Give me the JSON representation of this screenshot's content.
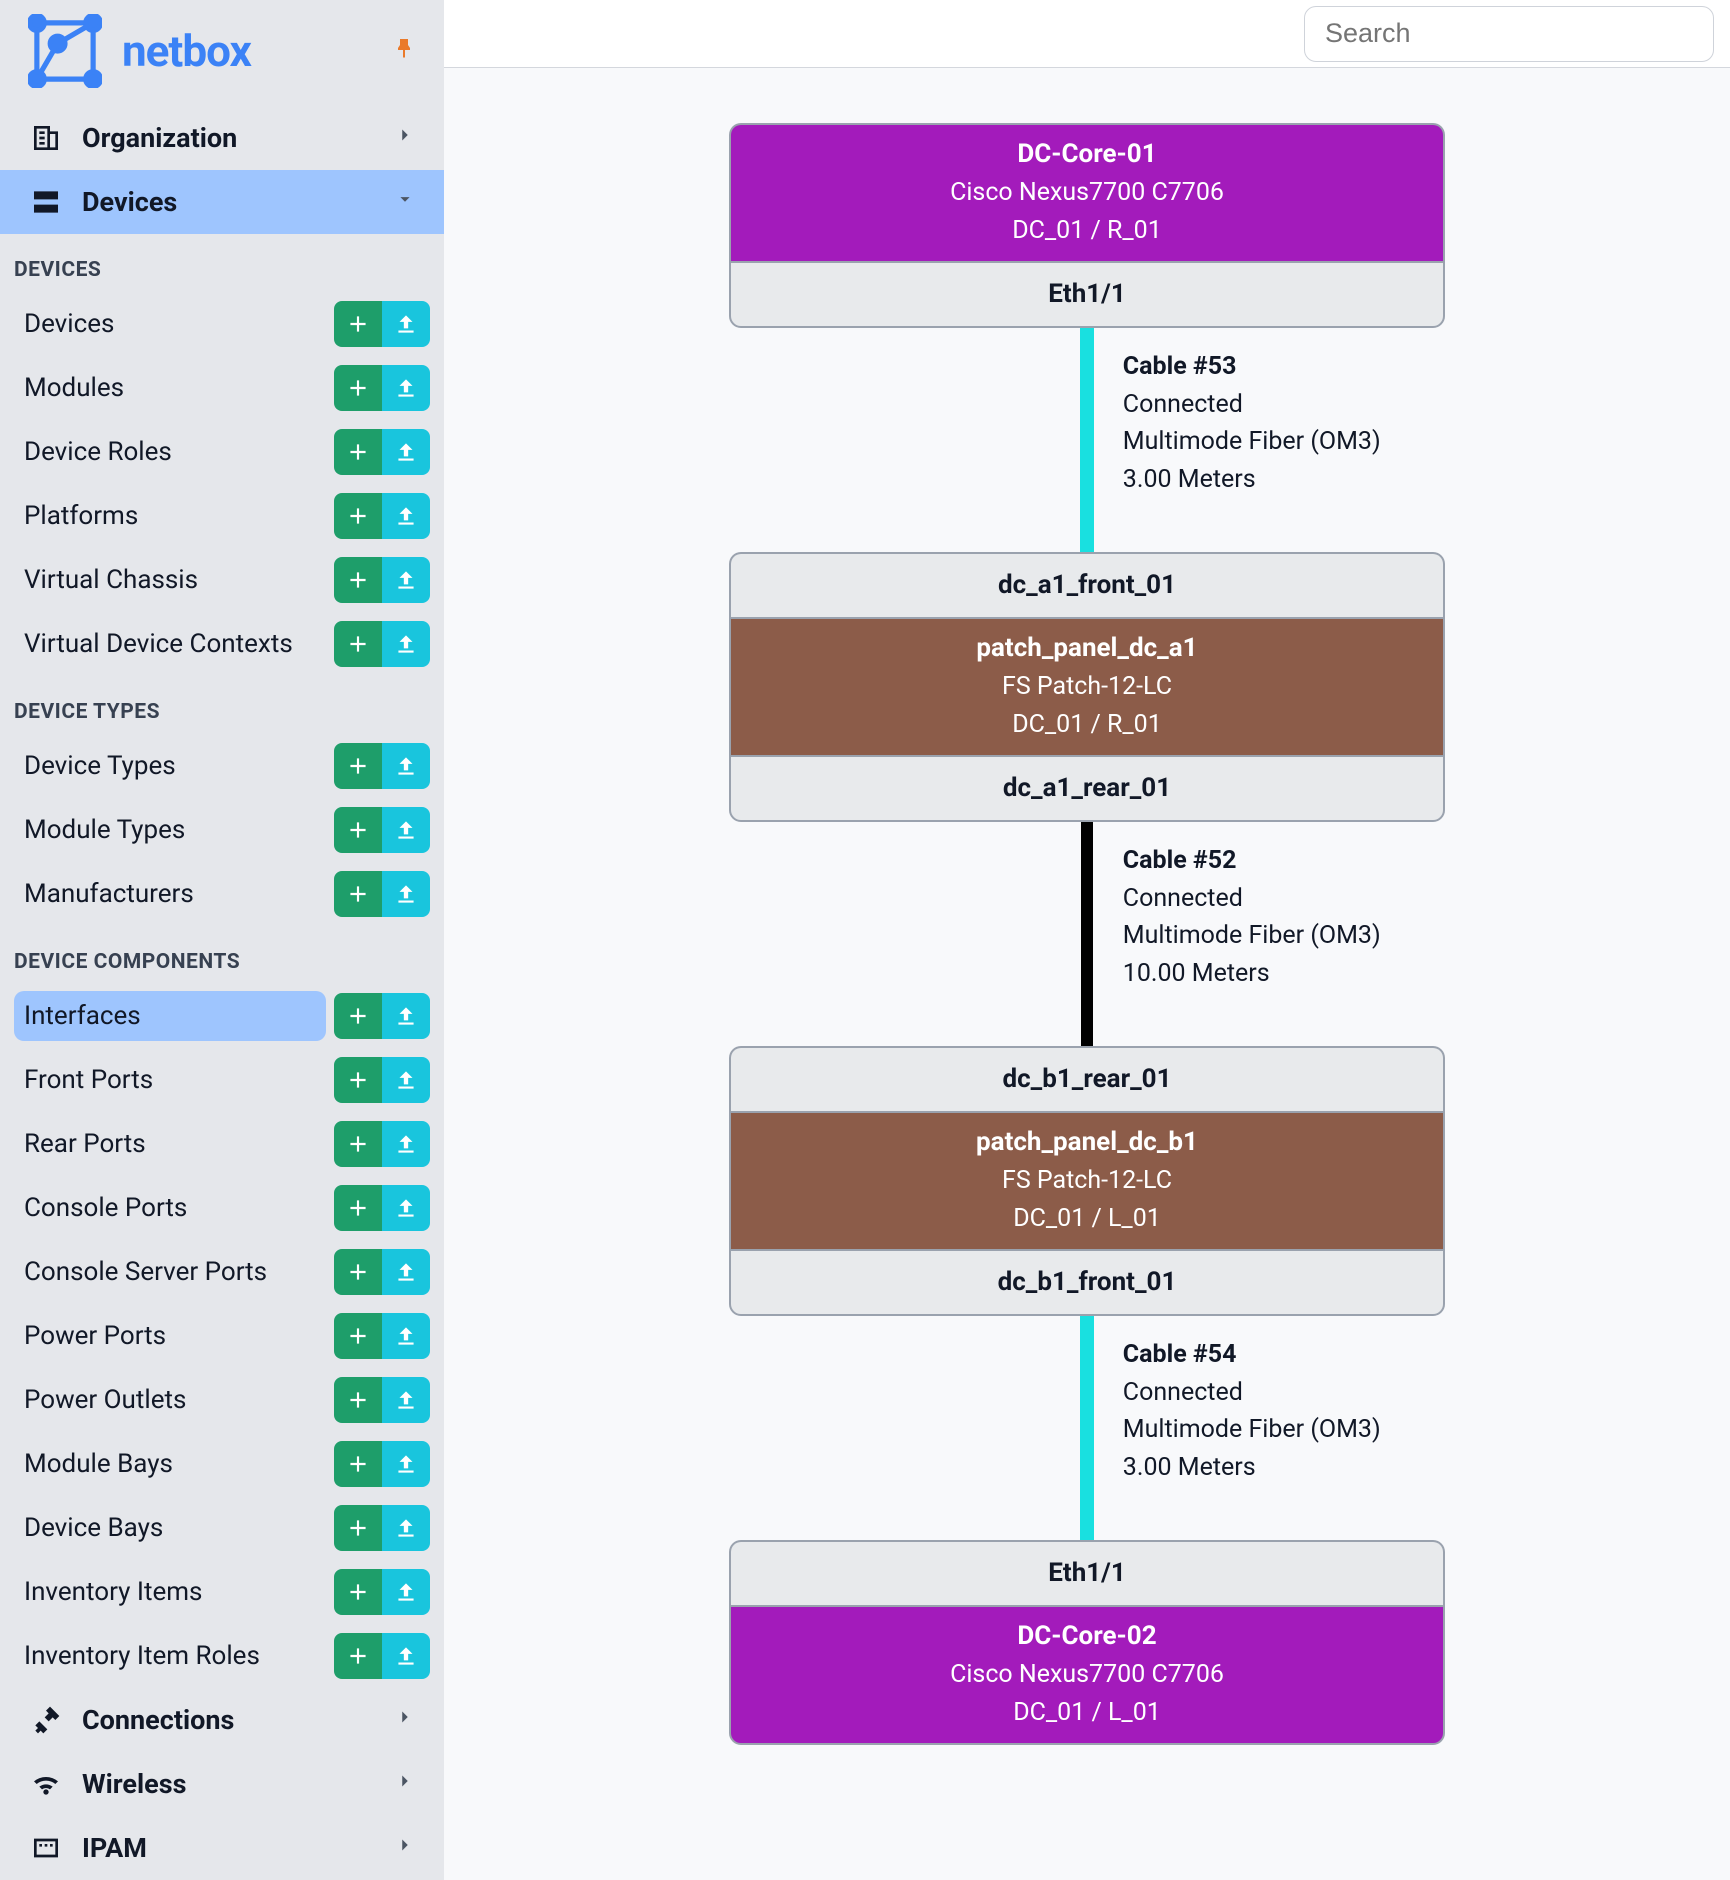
{
  "brand": "netbox",
  "search": {
    "placeholder": "Search"
  },
  "nav": {
    "sections": [
      {
        "label": "Organization",
        "icon": "org",
        "expanded": false
      },
      {
        "label": "Devices",
        "icon": "server",
        "expanded": true
      },
      {
        "label": "Connections",
        "icon": "plug",
        "expanded": false
      },
      {
        "label": "Wireless",
        "icon": "wifi",
        "expanded": false
      },
      {
        "label": "IPAM",
        "icon": "ipam",
        "expanded": false
      }
    ],
    "groups": [
      {
        "title": "DEVICES",
        "items": [
          {
            "label": "Devices"
          },
          {
            "label": "Modules"
          },
          {
            "label": "Device Roles"
          },
          {
            "label": "Platforms"
          },
          {
            "label": "Virtual Chassis"
          },
          {
            "label": "Virtual Device Contexts"
          }
        ]
      },
      {
        "title": "DEVICE TYPES",
        "items": [
          {
            "label": "Device Types"
          },
          {
            "label": "Module Types"
          },
          {
            "label": "Manufacturers"
          }
        ]
      },
      {
        "title": "DEVICE COMPONENTS",
        "items": [
          {
            "label": "Interfaces",
            "selected": true
          },
          {
            "label": "Front Ports"
          },
          {
            "label": "Rear Ports"
          },
          {
            "label": "Console Ports"
          },
          {
            "label": "Console Server Ports"
          },
          {
            "label": "Power Ports"
          },
          {
            "label": "Power Outlets"
          },
          {
            "label": "Module Bays"
          },
          {
            "label": "Device Bays"
          },
          {
            "label": "Inventory Items"
          },
          {
            "label": "Inventory Item Roles"
          }
        ]
      }
    ]
  },
  "trace": {
    "nodes": [
      {
        "kind": "group",
        "parts": [
          {
            "style": "device",
            "title": "DC-Core-01",
            "sub1": "Cisco Nexus7700 C7706",
            "sub2": "DC_01 / R_01"
          },
          {
            "style": "port",
            "title": "Eth1/1"
          }
        ]
      },
      {
        "kind": "cable",
        "color": "aqua",
        "name": "Cable #53",
        "status": "Connected",
        "type": "Multimode Fiber (OM3)",
        "length": "3.00 Meters"
      },
      {
        "kind": "group",
        "parts": [
          {
            "style": "port",
            "title": "dc_a1_front_01"
          },
          {
            "style": "patch",
            "title": "patch_panel_dc_a1",
            "sub1": "FS Patch-12-LC",
            "sub2": "DC_01 / R_01"
          },
          {
            "style": "port",
            "title": "dc_a1_rear_01"
          }
        ]
      },
      {
        "kind": "cable",
        "color": "black",
        "name": "Cable #52",
        "status": "Connected",
        "type": "Multimode Fiber (OM3)",
        "length": "10.00 Meters"
      },
      {
        "kind": "group",
        "parts": [
          {
            "style": "port",
            "title": "dc_b1_rear_01"
          },
          {
            "style": "patch",
            "title": "patch_panel_dc_b1",
            "sub1": "FS Patch-12-LC",
            "sub2": "DC_01 / L_01"
          },
          {
            "style": "port",
            "title": "dc_b1_front_01"
          }
        ]
      },
      {
        "kind": "cable",
        "color": "aqua",
        "name": "Cable #54",
        "status": "Connected",
        "type": "Multimode Fiber (OM3)",
        "length": "3.00 Meters"
      },
      {
        "kind": "group",
        "parts": [
          {
            "style": "port",
            "title": "Eth1/1"
          },
          {
            "style": "device",
            "title": "DC-Core-02",
            "sub1": "Cisco Nexus7700 C7706",
            "sub2": "DC_01 / L_01"
          }
        ]
      }
    ]
  }
}
